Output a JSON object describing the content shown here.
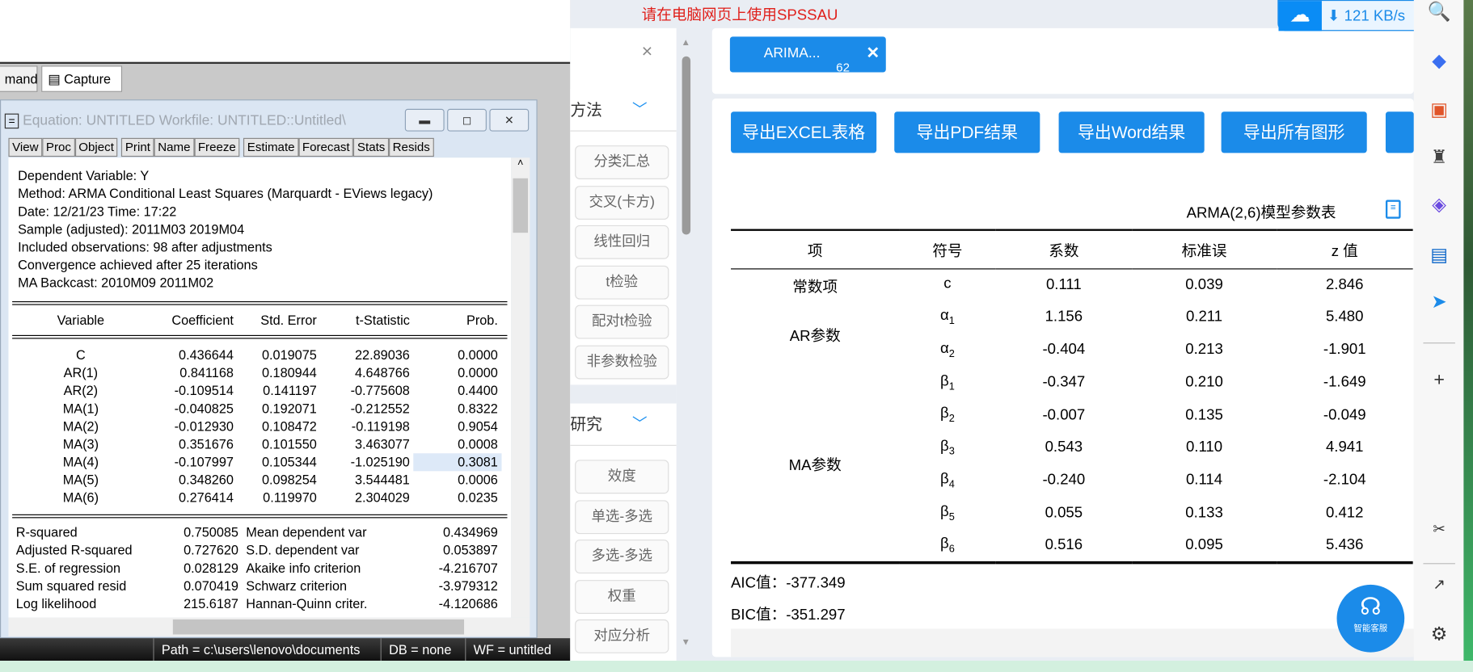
{
  "banner": "请在电脑网页上使用SPSSAU",
  "network": {
    "speed": "121 KB/s",
    "icon": "cloud-icon"
  },
  "eviews": {
    "tabs": [
      "mand",
      "Capture"
    ],
    "title": "Equation: UNTITLED   Workfile: UNTITLED::Untitled\\",
    "toolbar": [
      "View",
      "Proc",
      "Object",
      "Print",
      "Name",
      "Freeze",
      "Estimate",
      "Forecast",
      "Stats",
      "Resids"
    ],
    "header": [
      "Dependent Variable: Y",
      "Method: ARMA Conditional Least Squares (Marquardt - EViews legacy)",
      "Date: 12/21/23   Time: 17:22",
      "Sample (adjusted): 2011M03 2019M04",
      "Included observations: 98 after adjustments",
      "Convergence achieved after 25 iterations",
      "MA Backcast: 2010M09 2011M02"
    ],
    "columns": [
      "Variable",
      "Coefficient",
      "Std. Error",
      "t-Statistic",
      "Prob."
    ],
    "rows": [
      [
        "C",
        "0.436644",
        "0.019075",
        "22.89036",
        "0.0000"
      ],
      [
        "AR(1)",
        "0.841168",
        "0.180944",
        "4.648766",
        "0.0000"
      ],
      [
        "AR(2)",
        "-0.109514",
        "0.141197",
        "-0.775608",
        "0.4400"
      ],
      [
        "MA(1)",
        "-0.040825",
        "0.192071",
        "-0.212552",
        "0.8322"
      ],
      [
        "MA(2)",
        "-0.012930",
        "0.108472",
        "-0.119198",
        "0.9054"
      ],
      [
        "MA(3)",
        "0.351676",
        "0.101550",
        "3.463077",
        "0.0008"
      ],
      [
        "MA(4)",
        "-0.107997",
        "0.105344",
        "-1.025190",
        "0.3081"
      ],
      [
        "MA(5)",
        "0.348260",
        "0.098254",
        "3.544481",
        "0.0006"
      ],
      [
        "MA(6)",
        "0.276414",
        "0.119970",
        "2.304029",
        "0.0235"
      ]
    ],
    "stats": [
      [
        "R-squared",
        "0.750085",
        "Mean dependent var",
        "0.434969"
      ],
      [
        "Adjusted R-squared",
        "0.727620",
        "S.D. dependent var",
        "0.053897"
      ],
      [
        "S.E. of regression",
        "0.028129",
        "Akaike info criterion",
        "-4.216707"
      ],
      [
        "Sum squared resid",
        "0.070419",
        "Schwarz criterion",
        "-3.979312"
      ],
      [
        "Log likelihood",
        "215.6187",
        "Hannan-Quinn criter.",
        "-4.120686"
      ]
    ],
    "status": {
      "path": "Path = c:\\users\\lenovo\\documents",
      "db": "DB = none",
      "wf": "WF = untitled"
    }
  },
  "middle": {
    "section1": "方法",
    "buttons1": [
      "分类汇总",
      "交叉(卡方)",
      "线性回归",
      "t检验",
      "配对t检验",
      "非参数检验"
    ],
    "section2": "研究",
    "buttons2": [
      "效度",
      "单选-多选",
      "多选-多选",
      "权重",
      "对应分析"
    ]
  },
  "result_tab": {
    "label": "ARIMA...",
    "count": "62"
  },
  "export_buttons": [
    "导出EXCEL表格",
    "导出PDF结果",
    "导出Word结果",
    "导出所有图形"
  ],
  "table": {
    "title": "ARMA(2,6)模型参数表",
    "headers": [
      "项",
      "符号",
      "系数",
      "标准误",
      "z 值"
    ],
    "groups": [
      {
        "label": "常数项",
        "rows": 1
      },
      {
        "label": "AR参数",
        "rows": 2
      },
      {
        "label": "MA参数",
        "rows": 6
      }
    ],
    "rows": [
      {
        "sym": "c",
        "sub": "",
        "coef": "0.111",
        "se": "0.039",
        "z": "2.846"
      },
      {
        "sym": "α",
        "sub": "1",
        "coef": "1.156",
        "se": "0.211",
        "z": "5.480"
      },
      {
        "sym": "α",
        "sub": "2",
        "coef": "-0.404",
        "se": "0.213",
        "z": "-1.901"
      },
      {
        "sym": "β",
        "sub": "1",
        "coef": "-0.347",
        "se": "0.210",
        "z": "-1.649"
      },
      {
        "sym": "β",
        "sub": "2",
        "coef": "-0.007",
        "se": "0.135",
        "z": "-0.049"
      },
      {
        "sym": "β",
        "sub": "3",
        "coef": "0.543",
        "se": "0.110",
        "z": "4.941"
      },
      {
        "sym": "β",
        "sub": "4",
        "coef": "-0.240",
        "se": "0.114",
        "z": "-2.104"
      },
      {
        "sym": "β",
        "sub": "5",
        "coef": "0.055",
        "se": "0.133",
        "z": "0.412"
      },
      {
        "sym": "β",
        "sub": "6",
        "coef": "0.516",
        "se": "0.095",
        "z": "5.436"
      }
    ],
    "aic": "AIC值：-377.349",
    "bic": "BIC值：-351.297"
  },
  "chat": {
    "label": "智能客服"
  },
  "colors": {
    "accent": "#1b8be9",
    "banner": "#e0201b"
  }
}
